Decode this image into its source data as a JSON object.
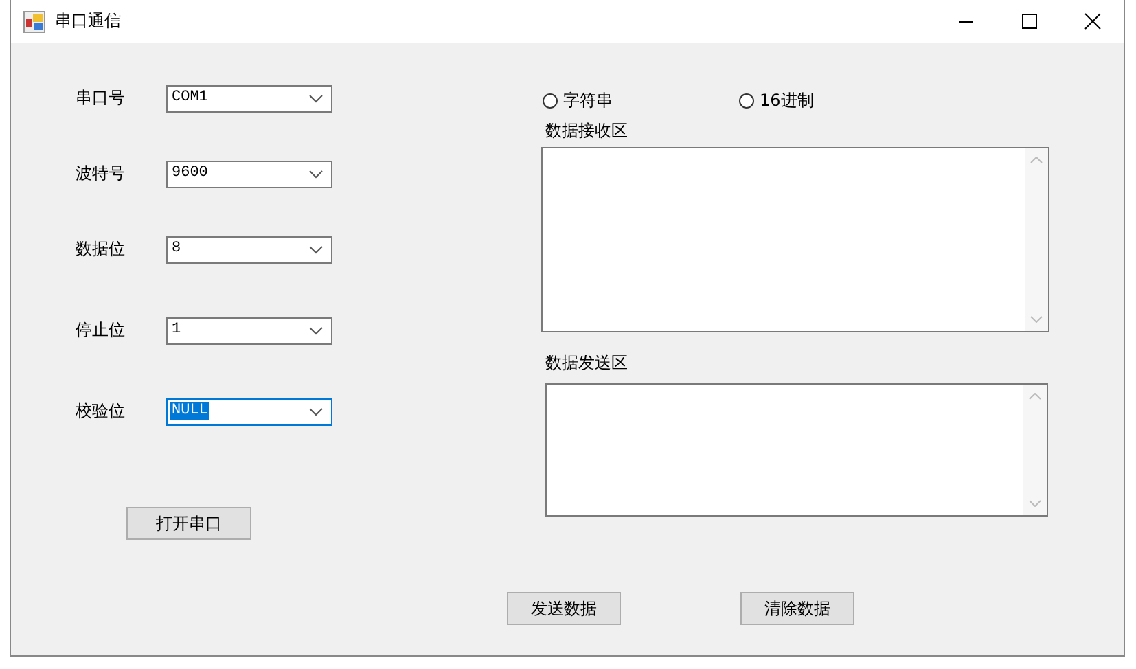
{
  "window": {
    "title": "串口通信"
  },
  "settings": [
    {
      "label": "串口号",
      "value": "COM1",
      "selected": false
    },
    {
      "label": "波特号",
      "value": "9600",
      "selected": false
    },
    {
      "label": "数据位",
      "value": "8",
      "selected": false
    },
    {
      "label": "停止位",
      "value": "1",
      "selected": false
    },
    {
      "label": "校验位",
      "value": "NULL",
      "selected": true
    }
  ],
  "open_button": "打开串口",
  "format_options": [
    {
      "label": "字符串",
      "checked": false
    },
    {
      "label": "16进制",
      "checked": false
    }
  ],
  "receive_area": {
    "label": "数据接收区"
  },
  "send_area": {
    "label": "数据发送区"
  },
  "buttons": [
    "发送数据",
    "清除数据"
  ]
}
